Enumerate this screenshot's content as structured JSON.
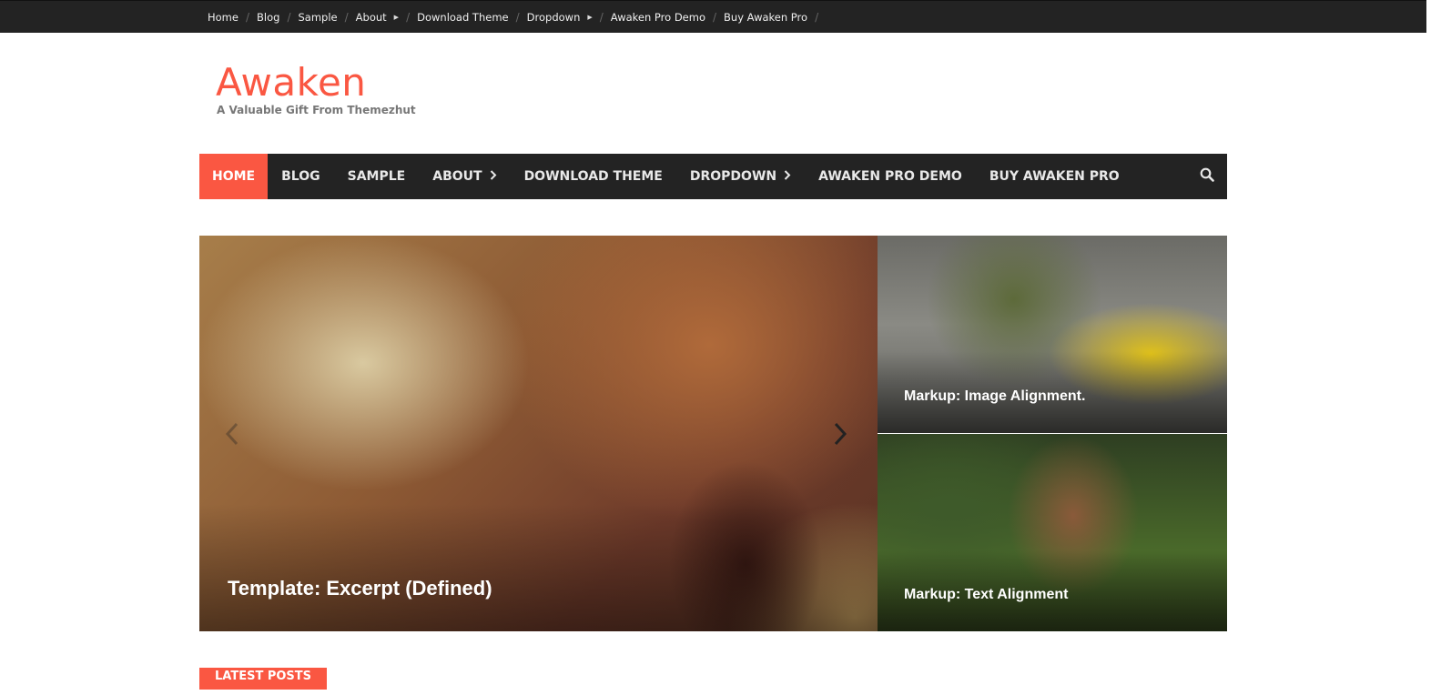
{
  "topbar": {
    "items": [
      {
        "label": "Home",
        "has_submenu": false
      },
      {
        "label": "Blog",
        "has_submenu": false
      },
      {
        "label": "Sample",
        "has_submenu": false
      },
      {
        "label": "About",
        "has_submenu": true
      },
      {
        "label": "Download Theme",
        "has_submenu": false
      },
      {
        "label": "Dropdown",
        "has_submenu": true
      },
      {
        "label": "Awaken Pro Demo",
        "has_submenu": false
      },
      {
        "label": "Buy Awaken Pro",
        "has_submenu": false
      }
    ],
    "separator": "/"
  },
  "header": {
    "title": "Awaken",
    "tagline": "A Valuable Gift From Themezhut"
  },
  "nav": {
    "items": [
      {
        "label": "Home",
        "active": true,
        "has_submenu": false
      },
      {
        "label": "Blog",
        "active": false,
        "has_submenu": false
      },
      {
        "label": "Sample",
        "active": false,
        "has_submenu": false
      },
      {
        "label": "About",
        "active": false,
        "has_submenu": true
      },
      {
        "label": "Download Theme",
        "active": false,
        "has_submenu": false
      },
      {
        "label": "Dropdown",
        "active": false,
        "has_submenu": true
      },
      {
        "label": "Awaken Pro Demo",
        "active": false,
        "has_submenu": false
      },
      {
        "label": "Buy Awaken Pro",
        "active": false,
        "has_submenu": false
      }
    ],
    "search_icon": "search-icon"
  },
  "slider": {
    "caption": "Template: Excerpt (Defined)",
    "prev_icon": "chevron-left-icon",
    "next_icon": "chevron-right-icon"
  },
  "featured": [
    {
      "caption": "Markup: Image Alignment."
    },
    {
      "caption": "Markup: Text Alignment"
    }
  ],
  "latest": {
    "label": "Latest Posts"
  },
  "colors": {
    "accent": "#fa5742",
    "dark_bar": "#232323",
    "tagline": "#777777"
  }
}
